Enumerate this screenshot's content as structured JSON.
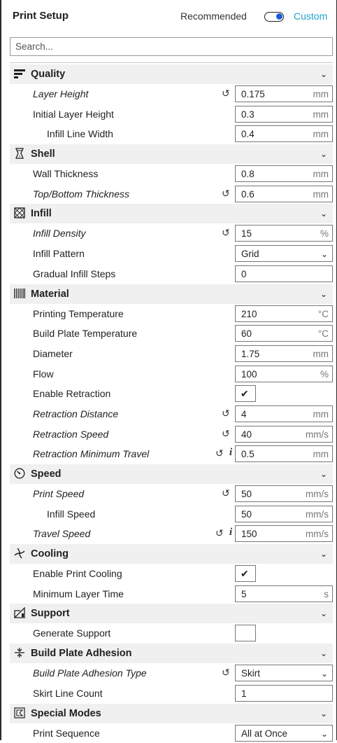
{
  "header": {
    "title": "Print Setup",
    "recommended_label": "Recommended",
    "custom_label": "Custom",
    "mode_toggle_state": "custom"
  },
  "search": {
    "placeholder": "Search...",
    "value": ""
  },
  "categories": [
    {
      "id": "quality",
      "label": "Quality",
      "icon": "quality-bars-icon",
      "settings": [
        {
          "label": "Layer Height",
          "value": "0.175",
          "unit": "mm",
          "italic": true,
          "reset": true
        },
        {
          "label": "Initial Layer Height",
          "value": "0.3",
          "unit": "mm"
        },
        {
          "label": "Infill Line Width",
          "value": "0.4",
          "unit": "mm",
          "indent": true
        }
      ]
    },
    {
      "id": "shell",
      "label": "Shell",
      "icon": "shell-icon",
      "settings": [
        {
          "label": "Wall Thickness",
          "value": "0.8",
          "unit": "mm"
        },
        {
          "label": "Top/Bottom Thickness",
          "value": "0.6",
          "unit": "mm",
          "italic": true,
          "reset": true
        }
      ]
    },
    {
      "id": "infill",
      "label": "Infill",
      "icon": "infill-icon",
      "settings": [
        {
          "label": "Infill Density",
          "value": "15",
          "unit": "%",
          "italic": true,
          "reset": true
        },
        {
          "label": "Infill Pattern",
          "value": "Grid",
          "type": "dropdown"
        },
        {
          "label": "Gradual Infill Steps",
          "value": "0",
          "unit": ""
        }
      ]
    },
    {
      "id": "material",
      "label": "Material",
      "icon": "material-icon",
      "settings": [
        {
          "label": "Printing Temperature",
          "value": "210",
          "unit": "°C"
        },
        {
          "label": "Build Plate Temperature",
          "value": "60",
          "unit": "°C"
        },
        {
          "label": "Diameter",
          "value": "1.75",
          "unit": "mm"
        },
        {
          "label": "Flow",
          "value": "100",
          "unit": "%"
        },
        {
          "label": "Enable Retraction",
          "type": "checkbox",
          "checked": true
        },
        {
          "label": "Retraction Distance",
          "value": "4",
          "unit": "mm",
          "italic": true,
          "reset": true
        },
        {
          "label": "Retraction Speed",
          "value": "40",
          "unit": "mm/s",
          "italic": true,
          "reset": true
        },
        {
          "label": "Retraction Minimum Travel",
          "value": "0.5",
          "unit": "mm",
          "italic": true,
          "reset": true,
          "info": true
        }
      ]
    },
    {
      "id": "speed",
      "label": "Speed",
      "icon": "speed-gauge-icon",
      "settings": [
        {
          "label": "Print Speed",
          "value": "50",
          "unit": "mm/s",
          "italic": true,
          "reset": true
        },
        {
          "label": "Infill Speed",
          "value": "50",
          "unit": "mm/s",
          "indent": true
        },
        {
          "label": "Travel Speed",
          "value": "150",
          "unit": "mm/s",
          "italic": true,
          "reset": true,
          "info": true
        }
      ]
    },
    {
      "id": "cooling",
      "label": "Cooling",
      "icon": "cooling-fan-icon",
      "settings": [
        {
          "label": "Enable Print Cooling",
          "type": "checkbox",
          "checked": true
        },
        {
          "label": "Minimum Layer Time",
          "value": "5",
          "unit": "s"
        }
      ]
    },
    {
      "id": "support",
      "label": "Support",
      "icon": "support-icon",
      "settings": [
        {
          "label": "Generate Support",
          "type": "checkbox",
          "checked": false
        }
      ]
    },
    {
      "id": "adhesion",
      "label": "Build Plate Adhesion",
      "icon": "adhesion-icon",
      "settings": [
        {
          "label": "Build Plate Adhesion Type",
          "value": "Skirt",
          "type": "dropdown",
          "italic": true,
          "reset": true
        },
        {
          "label": "Skirt Line Count",
          "value": "1",
          "unit": ""
        }
      ]
    },
    {
      "id": "special",
      "label": "Special Modes",
      "icon": "special-modes-icon",
      "settings": [
        {
          "label": "Print Sequence",
          "value": "All at Once",
          "type": "dropdown"
        }
      ]
    }
  ],
  "glyphs": {
    "reset": "↺",
    "info": "i",
    "check": "✔",
    "chevron": "⌄",
    "dropdown": "⌄"
  }
}
